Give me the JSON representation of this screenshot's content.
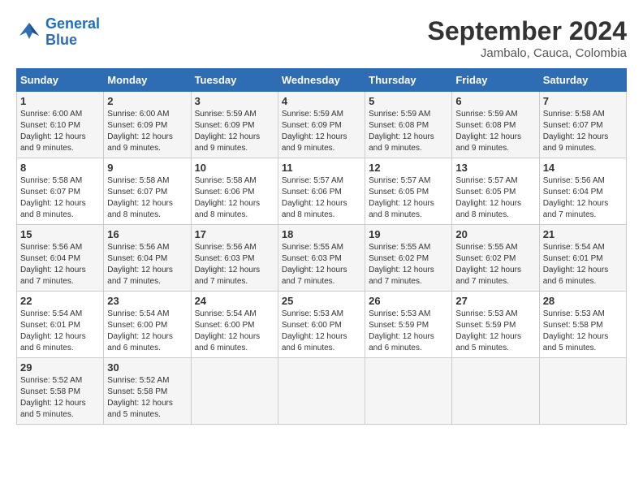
{
  "header": {
    "logo_line1": "General",
    "logo_line2": "Blue",
    "month": "September 2024",
    "location": "Jambalo, Cauca, Colombia"
  },
  "weekdays": [
    "Sunday",
    "Monday",
    "Tuesday",
    "Wednesday",
    "Thursday",
    "Friday",
    "Saturday"
  ],
  "weeks": [
    [
      {
        "day": "1",
        "sunrise": "Sunrise: 6:00 AM",
        "sunset": "Sunset: 6:10 PM",
        "daylight": "Daylight: 12 hours and 9 minutes."
      },
      {
        "day": "2",
        "sunrise": "Sunrise: 6:00 AM",
        "sunset": "Sunset: 6:09 PM",
        "daylight": "Daylight: 12 hours and 9 minutes."
      },
      {
        "day": "3",
        "sunrise": "Sunrise: 5:59 AM",
        "sunset": "Sunset: 6:09 PM",
        "daylight": "Daylight: 12 hours and 9 minutes."
      },
      {
        "day": "4",
        "sunrise": "Sunrise: 5:59 AM",
        "sunset": "Sunset: 6:09 PM",
        "daylight": "Daylight: 12 hours and 9 minutes."
      },
      {
        "day": "5",
        "sunrise": "Sunrise: 5:59 AM",
        "sunset": "Sunset: 6:08 PM",
        "daylight": "Daylight: 12 hours and 9 minutes."
      },
      {
        "day": "6",
        "sunrise": "Sunrise: 5:59 AM",
        "sunset": "Sunset: 6:08 PM",
        "daylight": "Daylight: 12 hours and 9 minutes."
      },
      {
        "day": "7",
        "sunrise": "Sunrise: 5:58 AM",
        "sunset": "Sunset: 6:07 PM",
        "daylight": "Daylight: 12 hours and 9 minutes."
      }
    ],
    [
      {
        "day": "8",
        "sunrise": "Sunrise: 5:58 AM",
        "sunset": "Sunset: 6:07 PM",
        "daylight": "Daylight: 12 hours and 8 minutes."
      },
      {
        "day": "9",
        "sunrise": "Sunrise: 5:58 AM",
        "sunset": "Sunset: 6:07 PM",
        "daylight": "Daylight: 12 hours and 8 minutes."
      },
      {
        "day": "10",
        "sunrise": "Sunrise: 5:58 AM",
        "sunset": "Sunset: 6:06 PM",
        "daylight": "Daylight: 12 hours and 8 minutes."
      },
      {
        "day": "11",
        "sunrise": "Sunrise: 5:57 AM",
        "sunset": "Sunset: 6:06 PM",
        "daylight": "Daylight: 12 hours and 8 minutes."
      },
      {
        "day": "12",
        "sunrise": "Sunrise: 5:57 AM",
        "sunset": "Sunset: 6:05 PM",
        "daylight": "Daylight: 12 hours and 8 minutes."
      },
      {
        "day": "13",
        "sunrise": "Sunrise: 5:57 AM",
        "sunset": "Sunset: 6:05 PM",
        "daylight": "Daylight: 12 hours and 8 minutes."
      },
      {
        "day": "14",
        "sunrise": "Sunrise: 5:56 AM",
        "sunset": "Sunset: 6:04 PM",
        "daylight": "Daylight: 12 hours and 7 minutes."
      }
    ],
    [
      {
        "day": "15",
        "sunrise": "Sunrise: 5:56 AM",
        "sunset": "Sunset: 6:04 PM",
        "daylight": "Daylight: 12 hours and 7 minutes."
      },
      {
        "day": "16",
        "sunrise": "Sunrise: 5:56 AM",
        "sunset": "Sunset: 6:04 PM",
        "daylight": "Daylight: 12 hours and 7 minutes."
      },
      {
        "day": "17",
        "sunrise": "Sunrise: 5:56 AM",
        "sunset": "Sunset: 6:03 PM",
        "daylight": "Daylight: 12 hours and 7 minutes."
      },
      {
        "day": "18",
        "sunrise": "Sunrise: 5:55 AM",
        "sunset": "Sunset: 6:03 PM",
        "daylight": "Daylight: 12 hours and 7 minutes."
      },
      {
        "day": "19",
        "sunrise": "Sunrise: 5:55 AM",
        "sunset": "Sunset: 6:02 PM",
        "daylight": "Daylight: 12 hours and 7 minutes."
      },
      {
        "day": "20",
        "sunrise": "Sunrise: 5:55 AM",
        "sunset": "Sunset: 6:02 PM",
        "daylight": "Daylight: 12 hours and 7 minutes."
      },
      {
        "day": "21",
        "sunrise": "Sunrise: 5:54 AM",
        "sunset": "Sunset: 6:01 PM",
        "daylight": "Daylight: 12 hours and 6 minutes."
      }
    ],
    [
      {
        "day": "22",
        "sunrise": "Sunrise: 5:54 AM",
        "sunset": "Sunset: 6:01 PM",
        "daylight": "Daylight: 12 hours and 6 minutes."
      },
      {
        "day": "23",
        "sunrise": "Sunrise: 5:54 AM",
        "sunset": "Sunset: 6:00 PM",
        "daylight": "Daylight: 12 hours and 6 minutes."
      },
      {
        "day": "24",
        "sunrise": "Sunrise: 5:54 AM",
        "sunset": "Sunset: 6:00 PM",
        "daylight": "Daylight: 12 hours and 6 minutes."
      },
      {
        "day": "25",
        "sunrise": "Sunrise: 5:53 AM",
        "sunset": "Sunset: 6:00 PM",
        "daylight": "Daylight: 12 hours and 6 minutes."
      },
      {
        "day": "26",
        "sunrise": "Sunrise: 5:53 AM",
        "sunset": "Sunset: 5:59 PM",
        "daylight": "Daylight: 12 hours and 6 minutes."
      },
      {
        "day": "27",
        "sunrise": "Sunrise: 5:53 AM",
        "sunset": "Sunset: 5:59 PM",
        "daylight": "Daylight: 12 hours and 5 minutes."
      },
      {
        "day": "28",
        "sunrise": "Sunrise: 5:53 AM",
        "sunset": "Sunset: 5:58 PM",
        "daylight": "Daylight: 12 hours and 5 minutes."
      }
    ],
    [
      {
        "day": "29",
        "sunrise": "Sunrise: 5:52 AM",
        "sunset": "Sunset: 5:58 PM",
        "daylight": "Daylight: 12 hours and 5 minutes."
      },
      {
        "day": "30",
        "sunrise": "Sunrise: 5:52 AM",
        "sunset": "Sunset: 5:58 PM",
        "daylight": "Daylight: 12 hours and 5 minutes."
      },
      null,
      null,
      null,
      null,
      null
    ]
  ]
}
